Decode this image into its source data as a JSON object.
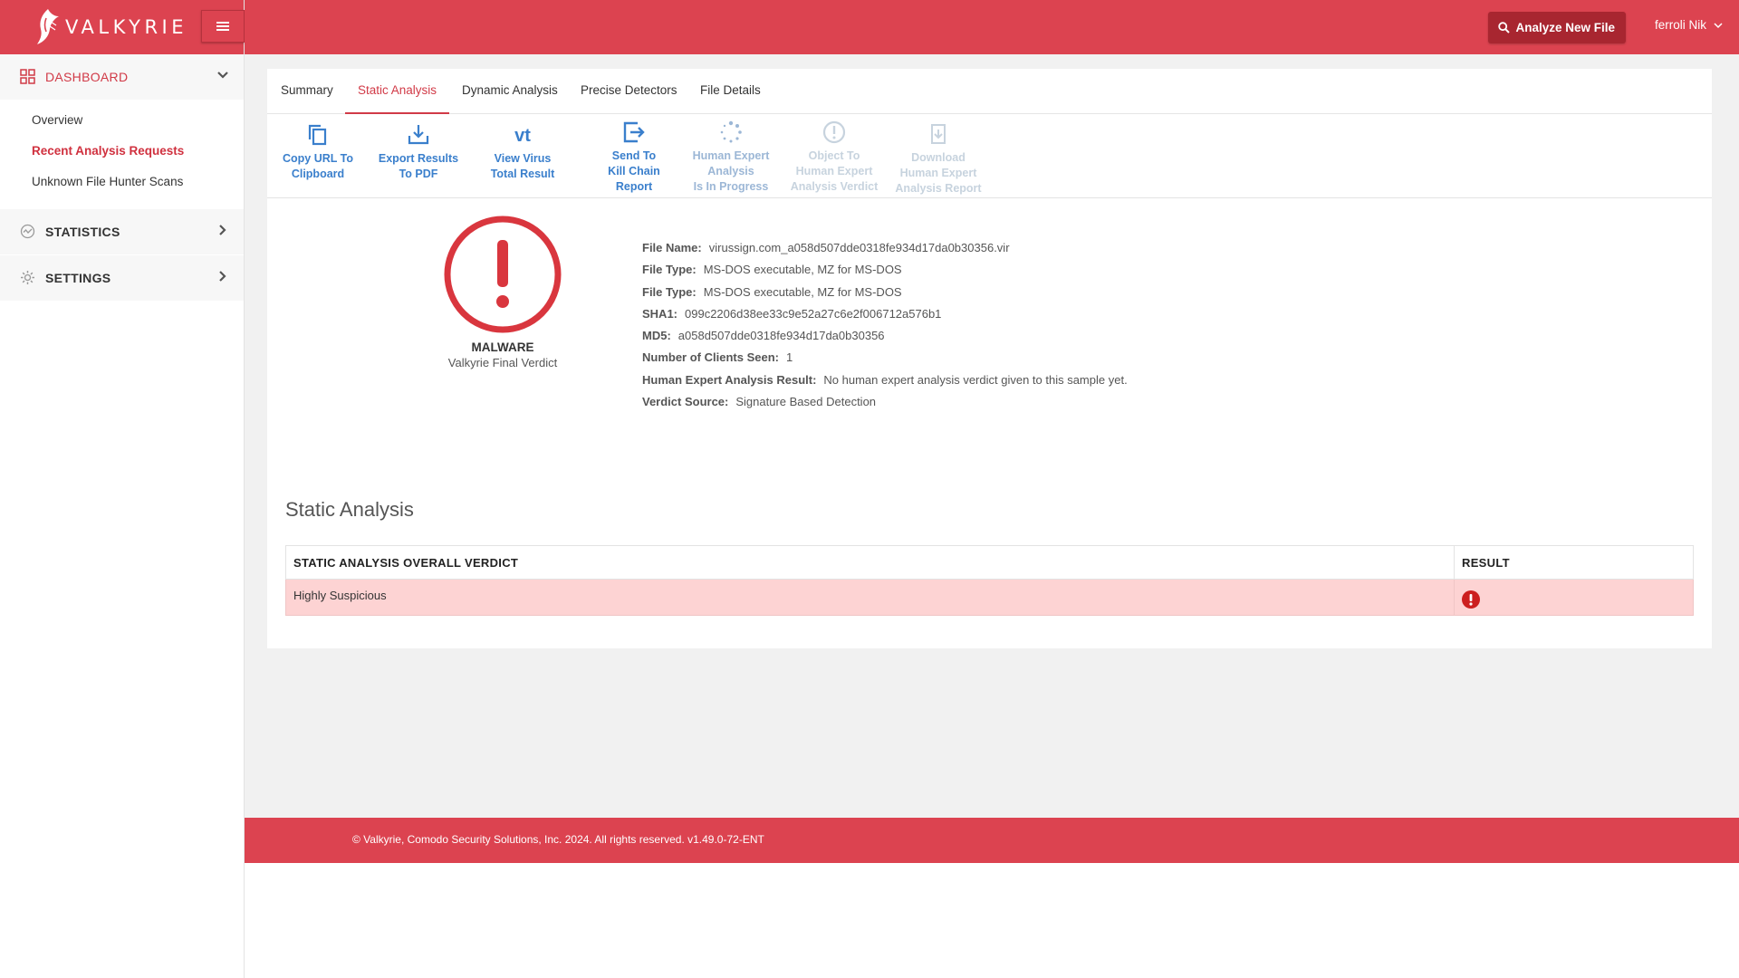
{
  "brand": {
    "name": "VALKYRIE"
  },
  "sidebar": {
    "dashboard": {
      "label": "DASHBOARD",
      "items": [
        "Overview",
        "Recent Analysis Requests",
        "Unknown File Hunter Scans"
      ]
    },
    "statistics": {
      "label": "STATISTICS"
    },
    "settings": {
      "label": "SETTINGS"
    }
  },
  "header": {
    "analyze_label": "Analyze New File",
    "user_name": "ferroli Nik"
  },
  "tabs": [
    "Summary",
    "Static Analysis",
    "Dynamic Analysis",
    "Precise Detectors",
    "File Details"
  ],
  "toolbar": [
    {
      "line1": "Copy URL To",
      "line2": "Clipboard",
      "line3": ""
    },
    {
      "line1": "Export Results",
      "line2": "To PDF",
      "line3": ""
    },
    {
      "line1": "View Virus",
      "line2": "Total Result",
      "line3": ""
    },
    {
      "line1": "Send To",
      "line2": "Kill Chain",
      "line3": "Report"
    },
    {
      "line1": "Human Expert",
      "line2": "Analysis",
      "line3": "Is In Progress"
    },
    {
      "line1": "Object To",
      "line2": "Human Expert",
      "line3": "Analysis Verdict"
    },
    {
      "line1": "Download",
      "line2": "Human Expert",
      "line3": "Analysis Report"
    }
  ],
  "verdict": {
    "label": "MALWARE",
    "sub": "Valkyrie Final Verdict",
    "color": "#d9363e"
  },
  "file_info": [
    {
      "key": "File Name:",
      "value": "virussign.com_a058d507dde0318fe934d17da0b30356.vir"
    },
    {
      "key": "File Type:",
      "value": "MS-DOS executable, MZ for MS-DOS"
    },
    {
      "key": "File Type:",
      "value": "MS-DOS executable, MZ for MS-DOS"
    },
    {
      "key": "SHA1:",
      "value": "099c2206d38ee33c9e52a27c6e2f006712a576b1"
    },
    {
      "key": "MD5:",
      "value": "a058d507dde0318fe934d17da0b30356"
    },
    {
      "key": "Number of Clients Seen:",
      "value": "1"
    },
    {
      "key": "Human Expert Analysis Result:",
      "value": "No human expert analysis verdict given to this sample yet."
    },
    {
      "key": "Verdict Source:",
      "value": "Signature Based Detection"
    }
  ],
  "static_analysis": {
    "title": "Static Analysis",
    "columns": [
      "STATIC ANALYSIS OVERALL VERDICT",
      "RESULT"
    ],
    "rows": [
      {
        "verdict": "Highly Suspicious",
        "result_icon": "exclamation-circle-icon"
      }
    ]
  },
  "footer": {
    "text": "© Valkyrie, Comodo Security Solutions, Inc. 2024. All rights reserved. v1.49.0-72-ENT"
  },
  "colors": {
    "brand_red": "#dc4350",
    "dark_red": "#a82630",
    "link_blue": "#3a7fcc",
    "row_highlight": "#fdd3d3"
  }
}
